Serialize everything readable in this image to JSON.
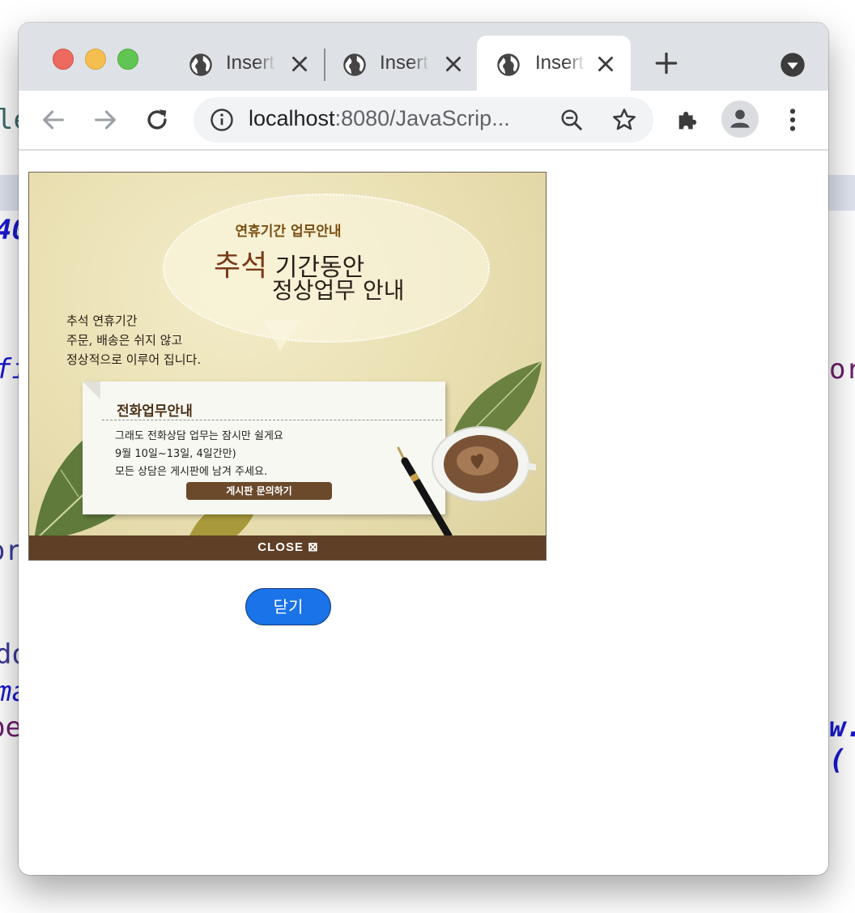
{
  "background_code": {
    "fragments": [
      "le",
      "40",
      "fi",
      "or",
      "or",
      "do",
      "ma",
      "pe",
      "w.("
    ]
  },
  "browser": {
    "tabs": [
      {
        "title": "Insert",
        "icon": "globe-icon",
        "active": false
      },
      {
        "title": "Insert",
        "icon": "globe-icon",
        "active": false
      },
      {
        "title": "Insert",
        "icon": "globe-icon",
        "active": true
      }
    ],
    "address": {
      "host": "localhost",
      "rest": ":8080/JavaScrip..."
    }
  },
  "popup": {
    "subtitle": "연휴기간 업무안내",
    "headline_accent": "추석",
    "headline_1": "기간동안",
    "headline_2": "정상업무 안내",
    "side_lines": [
      "추석 연휴기간",
      "주문, 배송은 쉬지 않고",
      "정상적으로 이루어 집니다."
    ],
    "note": {
      "title": "전화업무안내",
      "lines": [
        "그래도 전화상담 업무는 잠시만 쉴게요",
        "9월 10일~13일, 4일간만)",
        "모든 상담은 게시판에 남겨 주세요."
      ],
      "button_label": "게시판 문의하기"
    },
    "close_bar_label": "CLOSE ⊠"
  },
  "close_button_label": "닫기",
  "colors": {
    "accent": "#1a73e8",
    "close_bar": "#5f3f26",
    "titlebar": "#dee1e6"
  }
}
